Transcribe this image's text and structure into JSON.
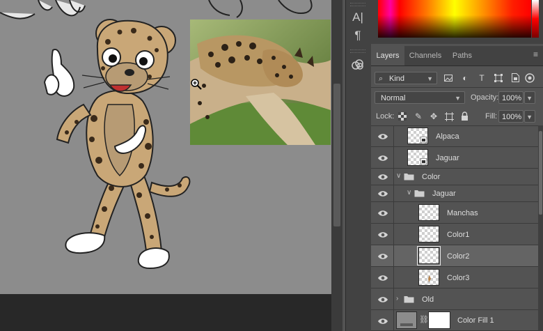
{
  "panel_tabs": [
    "Layers",
    "Channels",
    "Paths"
  ],
  "filter": {
    "kind": "Kind"
  },
  "blend": {
    "mode": "Normal",
    "opacity_label": "Opacity:",
    "opacity_value": "100%"
  },
  "lock": {
    "label": "Lock:",
    "fill_label": "Fill:",
    "fill_value": "100%"
  },
  "layers": [
    {
      "name": "Alpaca",
      "type": "smart-object"
    },
    {
      "name": "Jaguar",
      "type": "smart-object"
    },
    {
      "name": "Color",
      "type": "group",
      "expanded": true
    },
    {
      "name": "Jaguar",
      "type": "group",
      "expanded": true
    },
    {
      "name": "Manchas",
      "type": "layer"
    },
    {
      "name": "Color1",
      "type": "layer"
    },
    {
      "name": "Color2",
      "type": "layer",
      "selected": true
    },
    {
      "name": "Color3",
      "type": "layer"
    },
    {
      "name": "Old",
      "type": "group",
      "expanded": false
    },
    {
      "name": "Color Fill 1",
      "type": "fill-layer"
    }
  ],
  "colors": {
    "canvas": "#8c8c8c",
    "panel": "#535353",
    "selected_row": "#646464"
  },
  "icons": [
    "character-panel-icon",
    "paragraph-panel-icon",
    "libraries-icon",
    "zoom-in-cursor-icon",
    "eye-icon",
    "folder-icon",
    "link-icon"
  ]
}
